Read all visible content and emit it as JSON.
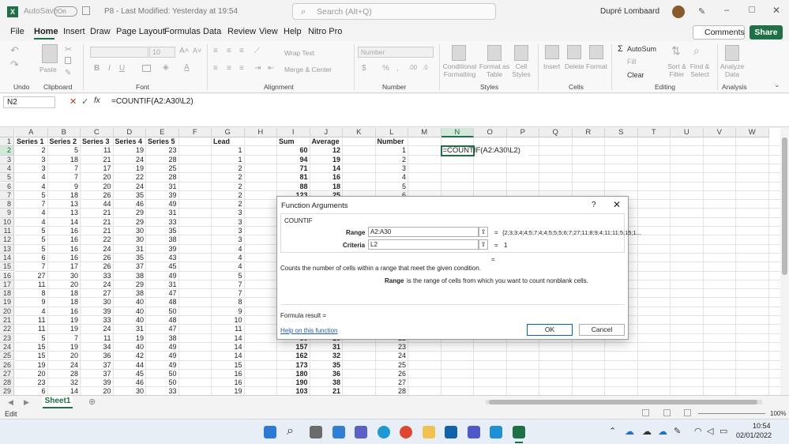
{
  "title_bar": {
    "autosave": "AutoSave",
    "toggle": "On",
    "doc_title": "P8 - Last Modified: Yesterday at 19:54",
    "search_placeholder": "Search (Alt+Q)",
    "user": "Dupré Lombaard"
  },
  "menu": {
    "items": [
      "File",
      "Home",
      "Insert",
      "Draw",
      "Page Layout",
      "Formulas",
      "Data",
      "Review",
      "View",
      "Help",
      "Nitro Pro"
    ],
    "active": "Home",
    "comments": "Comments",
    "share": "Share"
  },
  "ribbon": {
    "groups": [
      "Undo",
      "Clipboard",
      "Font",
      "Alignment",
      "Number",
      "Styles",
      "Cells",
      "Editing",
      "Analysis"
    ],
    "paste": "Paste",
    "font_size": "10",
    "wrap_text": "Wrap Text",
    "merge_center": "Merge & Center",
    "number_format": "Number",
    "conditional_formatting": "Conditional Formatting",
    "format_as_table": "Format as Table",
    "cell_styles": "Cell Styles",
    "insert": "Insert",
    "delete": "Delete",
    "format": "Format",
    "autosum": "AutoSum",
    "fill": "Fill",
    "clear": "Clear",
    "sort_filter": "Sort & Filter",
    "find_select": "Find & Select",
    "analyze_data": "Analyze Data"
  },
  "formula_bar": {
    "name_box": "N2",
    "fx": "fx",
    "formula": "=COUNTIF(A2:A30\\L2)"
  },
  "grid": {
    "columns": [
      "A",
      "B",
      "C",
      "D",
      "E",
      "F",
      "G",
      "H",
      "I",
      "J",
      "K",
      "L",
      "M",
      "N",
      "O",
      "P",
      "Q",
      "R",
      "S",
      "T",
      "U",
      "V",
      "W"
    ],
    "rows": [
      "1",
      "2",
      "3",
      "4",
      "5",
      "6",
      "7",
      "8",
      "9",
      "10",
      "11",
      "12",
      "13",
      "14",
      "15",
      "16",
      "17",
      "18",
      "19",
      "20",
      "21",
      "22",
      "23",
      "24",
      "25",
      "26",
      "27",
      "28",
      "29"
    ],
    "headers": {
      "A": "Series 1",
      "B": "Series 2",
      "C": "Series 3",
      "D": "Series 4",
      "E": "Series 5",
      "G": "Lead",
      "I": "Sum",
      "J": "Average",
      "L": "Number"
    },
    "A": [
      "2",
      "3",
      "3",
      "4",
      "4",
      "5",
      "7",
      "4",
      "4",
      "5",
      "5",
      "5",
      "6",
      "7",
      "27",
      "11",
      "8",
      "9",
      "4",
      "11",
      "11",
      "5",
      "15",
      "15",
      "19",
      "20",
      "23",
      "6"
    ],
    "B": [
      "5",
      "18",
      "7",
      "7",
      "9",
      "18",
      "13",
      "13",
      "14",
      "16",
      "16",
      "16",
      "16",
      "17",
      "30",
      "20",
      "18",
      "18",
      "16",
      "19",
      "19",
      "7",
      "19",
      "20",
      "24",
      "28",
      "32",
      "14"
    ],
    "C": [
      "11",
      "21",
      "17",
      "20",
      "20",
      "26",
      "44",
      "21",
      "21",
      "21",
      "22",
      "24",
      "26",
      "26",
      "33",
      "24",
      "27",
      "30",
      "39",
      "33",
      "24",
      "11",
      "34",
      "36",
      "37",
      "37",
      "39",
      "20"
    ],
    "D": [
      "19",
      "24",
      "19",
      "22",
      "24",
      "35",
      "46",
      "29",
      "29",
      "30",
      "30",
      "31",
      "35",
      "37",
      "38",
      "29",
      "38",
      "40",
      "40",
      "40",
      "31",
      "19",
      "40",
      "42",
      "44",
      "45",
      "46",
      "30"
    ],
    "E": [
      "23",
      "28",
      "25",
      "28",
      "31",
      "39",
      "49",
      "31",
      "33",
      "35",
      "38",
      "39",
      "43",
      "45",
      "49",
      "31",
      "47",
      "48",
      "50",
      "48",
      "47",
      "38",
      "49",
      "49",
      "49",
      "50",
      "50",
      "33"
    ],
    "G": [
      "1",
      "1",
      "2",
      "2",
      "2",
      "2",
      "2",
      "3",
      "3",
      "3",
      "3",
      "4",
      "4",
      "4",
      "5",
      "7",
      "7",
      "8",
      "9",
      "10",
      "11",
      "14",
      "14",
      "14",
      "15",
      "16",
      "16",
      "19"
    ],
    "I": [
      "60",
      "94",
      "71",
      "81",
      "88",
      "123",
      "",
      "",
      "",
      "",
      "",
      "",
      "",
      "",
      "",
      "",
      "",
      "",
      "",
      "",
      "",
      "80",
      "157",
      "162",
      "173",
      "180",
      "190",
      "103"
    ],
    "J": [
      "12",
      "19",
      "14",
      "16",
      "18",
      "25",
      "",
      "",
      "",
      "",
      "",
      "",
      "",
      "",
      "",
      "",
      "",
      "",
      "",
      "",
      "",
      "16",
      "31",
      "32",
      "35",
      "36",
      "38",
      "21"
    ],
    "L": [
      "1",
      "2",
      "3",
      "4",
      "5",
      "6",
      "",
      "",
      "",
      "",
      "",
      "",
      "",
      "",
      "",
      "",
      "",
      "",
      "",
      "",
      "",
      "22",
      "23",
      "24",
      "25",
      "26",
      "27",
      "28"
    ],
    "active_cell_text": "=COUNTIF(A2:A30\\L2)"
  },
  "dialog": {
    "title": "Function Arguments",
    "help_q": "?",
    "function": "COUNTIF",
    "range_label": "Range",
    "range_value": "A2:A30",
    "range_result": "{2;3;3;4;4;5;7;4;4;5;5;5;6;7;27;11;8;9;4;11;11;5;15;1...",
    "criteria_label": "Criteria",
    "criteria_value": "L2",
    "criteria_result": "1",
    "eq": "=",
    "description": "Counts the number of cells within a range that meet the given condition.",
    "arg_name": "Range",
    "arg_desc": "is the range of cells from which you want to count nonblank cells.",
    "formula_result": "Formula result =",
    "help_link": "Help on this function",
    "ok": "OK",
    "cancel": "Cancel"
  },
  "sheet": {
    "tab": "Sheet1"
  },
  "status": {
    "mode": "Edit",
    "zoom": "100%"
  },
  "taskbar": {
    "time": "10:54",
    "date": "02/01/2022"
  }
}
